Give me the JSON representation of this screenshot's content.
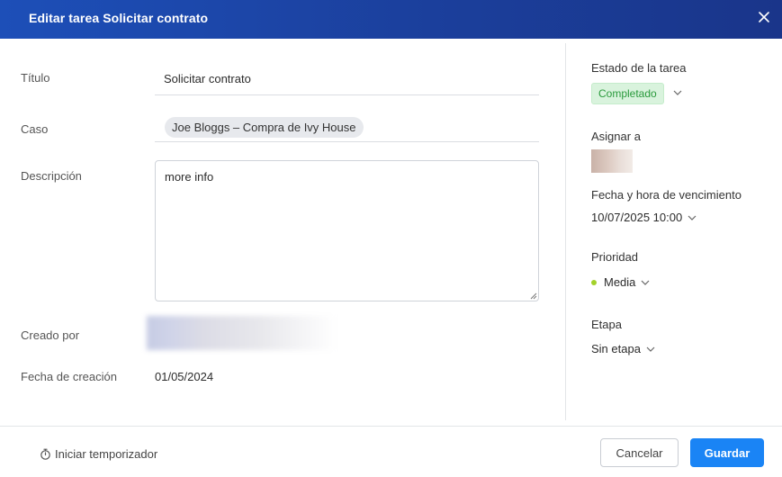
{
  "dialog": {
    "title": "Editar tarea Solicitar contrato"
  },
  "form": {
    "title_label": "Título",
    "title_value": "Solicitar contrato",
    "case_label": "Caso",
    "case_value": "Joe Bloggs – Compra de Ivy House",
    "description_label": "Descripción",
    "description_value": "more info",
    "created_by_label": "Creado por",
    "created_date_label": "Fecha de creación",
    "created_date_value": "01/05/2024"
  },
  "sidebar": {
    "status_label": "Estado de la tarea",
    "status_value": "Completado",
    "assign_label": "Asignar a",
    "due_label": "Fecha y hora de vencimiento",
    "due_value": "10/07/2025 10:00",
    "priority_label": "Prioridad",
    "priority_value": "Media",
    "stage_label": "Etapa",
    "stage_value": "Sin etapa"
  },
  "footer": {
    "timer_label": "Iniciar temporizador",
    "cancel_label": "Cancelar",
    "save_label": "Guardar"
  },
  "colors": {
    "header": "#1d4fb8",
    "status_bg": "#d9f3dd",
    "status_text": "#2a9a3c",
    "priority_dot": "#a3d12a",
    "primary_button": "#1a84f5"
  },
  "icons": {
    "close": "close-icon",
    "chevron": "chevron-down-icon",
    "timer": "stopwatch-icon"
  }
}
